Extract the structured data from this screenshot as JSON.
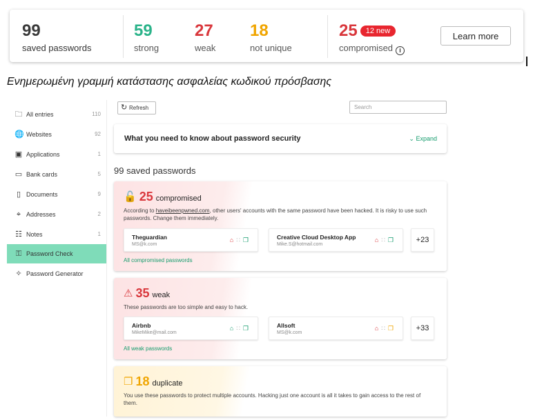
{
  "status_bar": {
    "saved": {
      "value": "99",
      "label": "saved passwords"
    },
    "strong": {
      "value": "59",
      "label": "strong"
    },
    "weak": {
      "value": "27",
      "label": "weak"
    },
    "not_unique": {
      "value": "18",
      "label": "not unique"
    },
    "compromised": {
      "value": "25",
      "label": "compromised",
      "badge": "12 new"
    },
    "learn_more": "Learn more"
  },
  "caption": "Ενημερωμένη γραμμή κατάστασης ασφαλείας κωδικού πρόσβασης",
  "sidebar": {
    "items": [
      {
        "label": "All entries",
        "count": "110",
        "icon": "folder-icon"
      },
      {
        "label": "Websites",
        "count": "92",
        "icon": "globe-icon"
      },
      {
        "label": "Applications",
        "count": "1",
        "icon": "applications-icon"
      },
      {
        "label": "Bank cards",
        "count": "5",
        "icon": "credit-card-icon"
      },
      {
        "label": "Documents",
        "count": "9",
        "icon": "document-icon"
      },
      {
        "label": "Addresses",
        "count": "2",
        "icon": "location-pin-icon"
      },
      {
        "label": "Notes",
        "count": "1",
        "icon": "notes-icon"
      },
      {
        "label": "Password Check",
        "count": "",
        "icon": "key-icon"
      },
      {
        "label": "Password Generator",
        "count": "",
        "icon": "magic-wand-icon"
      }
    ]
  },
  "toolbar": {
    "refresh": "Refresh",
    "search_placeholder": "Search"
  },
  "info": {
    "title": "What you need to know about password security",
    "expand": "Expand"
  },
  "saved_title": "99 saved passwords",
  "compromised": {
    "count": "25",
    "label": "compromised",
    "desc_prefix": "According to ",
    "desc_link": "haveibeenpwned.com",
    "desc_suffix": ", other users' accounts with the same password have been hacked. It is risky to use such passwords. Change them immediately.",
    "entries": [
      {
        "name": "Theguardian",
        "user": "MS@k.com"
      },
      {
        "name": "Creative Cloud Desktop App",
        "user": "Mike.S@hotmail.com"
      }
    ],
    "more": "+23",
    "link": "All compromised passwords"
  },
  "weak": {
    "count": "35",
    "label": "weak",
    "desc": "These passwords are too simple and easy to hack.",
    "entries": [
      {
        "name": "Airbnb",
        "user": "MikeMike@mail.com"
      },
      {
        "name": "Allsoft",
        "user": "MS@k.com"
      }
    ],
    "more": "+33",
    "link": "All weak passwords"
  },
  "duplicate": {
    "count": "18",
    "label": "duplicate",
    "desc": "You use these passwords to protect multiple accounts. Hacking just one account is all it takes to gain access to the rest of them."
  },
  "colors": {
    "strong": "#2bb38a",
    "weak": "#d9373c",
    "not_unique": "#f0a500",
    "compromised": "#d9373c",
    "accent": "#159c6d",
    "active_nav": "#7fdcb9"
  }
}
